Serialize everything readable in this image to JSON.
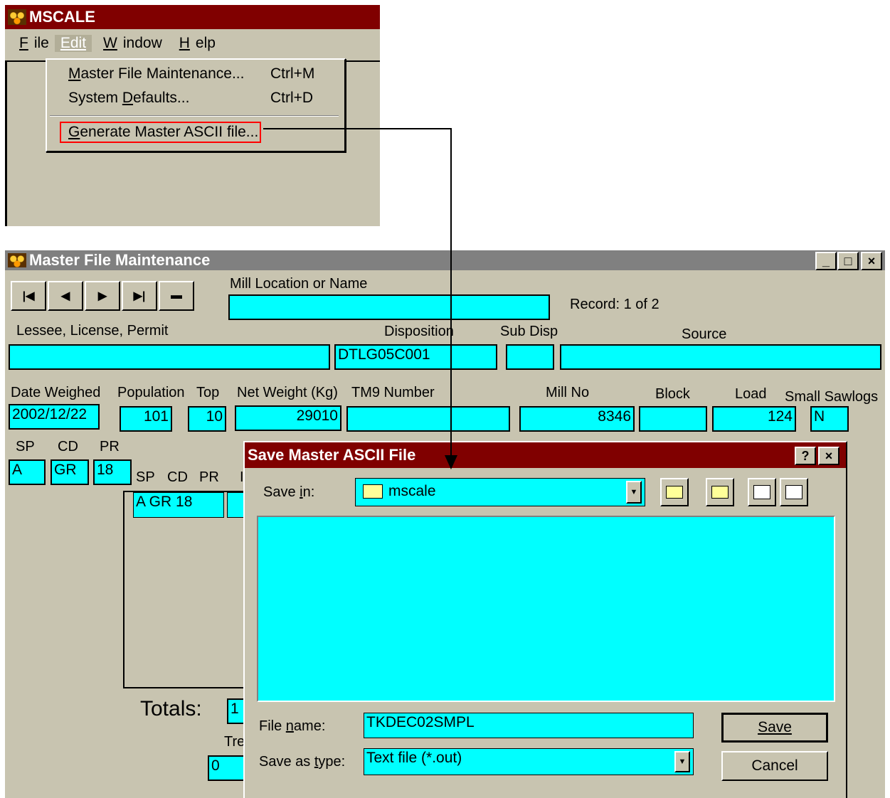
{
  "mscale_window": {
    "title": "MSCALE",
    "menu": [
      "File",
      "Edit",
      "Window",
      "Help"
    ],
    "edit_menu": [
      {
        "label": "Master File Maintenance...",
        "shortcut": "Ctrl+M"
      },
      {
        "label": "System Defaults...",
        "shortcut": "Ctrl+D"
      },
      {
        "label": "Generate Master ASCII file...",
        "shortcut": ""
      }
    ]
  },
  "master_window": {
    "title": "Master File Maintenance",
    "sys_buttons": [
      "_",
      "□",
      "×"
    ],
    "nav_buttons": [
      "first",
      "prev",
      "next",
      "last",
      "delete"
    ],
    "labels": {
      "mill_location": "Mill Location or Name",
      "record": "Record: 1 of 2",
      "lessee": "Lessee, License, Permit",
      "disposition": "Disposition",
      "sub_disp": "Sub Disp",
      "source": "Source",
      "date_weighed": "Date Weighed",
      "population": "Population",
      "top": "Top",
      "net_weight": "Net Weight (Kg)",
      "tm9": "TM9 Number",
      "mill_no": "Mill No",
      "block": "Block",
      "load": "Load",
      "small_sawlogs": "Small Sawlogs",
      "sp": "SP",
      "cd": "CD",
      "pr": "PR",
      "grid_sp": "SP",
      "grid_cd": "CD",
      "grid_pr": "PR",
      "totals": "Totals:",
      "tre": "Tre"
    },
    "values": {
      "mill_location": "",
      "lessee": "",
      "disposition": "DTLG05C001",
      "sub_disp": "",
      "source": "",
      "date_weighed": "2002/12/22",
      "population": "101",
      "top": "10",
      "net_weight": "29010",
      "tm9": "",
      "mill_no": "8346",
      "block": "",
      "load": "124",
      "small_sawlogs": "N",
      "sp": "A",
      "cd": "GR",
      "pr": "18",
      "grid_row": "A  GR 18",
      "totals_value": "1",
      "tre_value": "0"
    }
  },
  "save_dialog": {
    "title": "Save Master ASCII File",
    "help_btn": "?",
    "close_btn": "×",
    "save_in_label": "Save in:",
    "save_in_value": "mscale",
    "file_name_label": "File name:",
    "file_name_value": "TKDEC02SMPL",
    "save_type_label": "Save as type:",
    "save_type_value": "Text file (*.out)",
    "save_button": "Save",
    "cancel_button": "Cancel"
  },
  "colors": {
    "titlebar": "#800000",
    "field": "#00ffff",
    "window": "#c8c4b0",
    "highlight": "#ff0000"
  }
}
